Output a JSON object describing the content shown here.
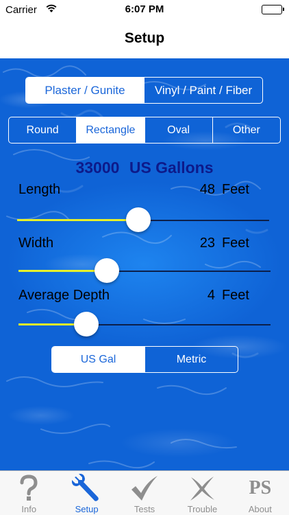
{
  "status": {
    "carrier": "Carrier",
    "time": "6:07 PM"
  },
  "nav": {
    "title": "Setup"
  },
  "pool_type": {
    "options": [
      "Plaster / Gunite",
      "Vinyl / Paint / Fiber"
    ],
    "selected": 0
  },
  "shape": {
    "options": [
      "Round",
      "Rectangle",
      "Oval",
      "Other"
    ],
    "selected": 1
  },
  "volume": {
    "value": "33000",
    "unit": "US Gallons"
  },
  "dimensions": [
    {
      "label": "Length",
      "value": "48",
      "unit": "Feet",
      "slider_fraction": 0.48
    },
    {
      "label": "Width",
      "value": "23",
      "unit": "Feet",
      "slider_fraction": 0.35
    },
    {
      "label": "Average Depth",
      "value": "4",
      "unit": "Feet",
      "slider_fraction": 0.27
    }
  ],
  "units": {
    "options": [
      "US Gal",
      "Metric"
    ],
    "selected": 0
  },
  "tabs": [
    {
      "label": "Info",
      "icon": "question-icon"
    },
    {
      "label": "Setup",
      "icon": "wrench-icon"
    },
    {
      "label": "Tests",
      "icon": "checkmark-icon"
    },
    {
      "label": "Trouble",
      "icon": "x-mark-icon"
    },
    {
      "label": "About",
      "icon": "ps-logo-icon",
      "icon_text": "PS"
    }
  ],
  "active_tab": 1,
  "colors": {
    "accent": "#1a66d9",
    "water": "#1276e6",
    "slider_fill": "#e7f12a",
    "slider_track": "#0c1f4a",
    "volume_text": "#0d1a8a",
    "tab_inactive": "#8e8e8e"
  }
}
